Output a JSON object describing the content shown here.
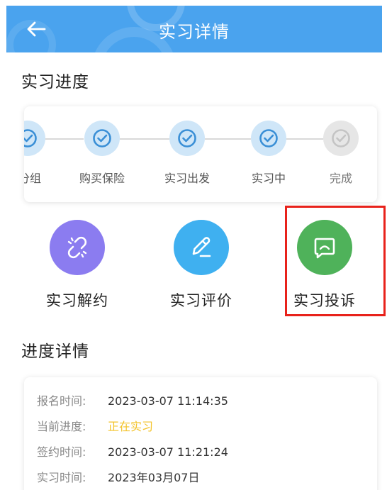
{
  "header": {
    "title": "实习详情"
  },
  "progress": {
    "section_title": "实习进度",
    "steps": [
      {
        "label": "分组",
        "state": "done"
      },
      {
        "label": "购买保险",
        "state": "done"
      },
      {
        "label": "实习出发",
        "state": "done"
      },
      {
        "label": "实习中",
        "state": "done"
      },
      {
        "label": "完成",
        "state": "todo"
      }
    ]
  },
  "actions": [
    {
      "label": "实习解约",
      "icon": "broken-link-icon",
      "color": "#8b7cf0"
    },
    {
      "label": "实习评价",
      "icon": "edit-pen-icon",
      "color": "#3fb0f0"
    },
    {
      "label": "实习投诉",
      "icon": "message-complaint-icon",
      "color": "#4fb25a"
    }
  ],
  "details": {
    "section_title": "进度详情",
    "rows": [
      {
        "key": "报名时间:",
        "value": "2023-03-07 11:14:35"
      },
      {
        "key": "当前进度:",
        "value": "正在实习"
      },
      {
        "key": "签约时间:",
        "value": "2023-03-07 11:21:24"
      },
      {
        "key": "实习时间:",
        "value": "2023年03月07日"
      }
    ]
  },
  "colors": {
    "header": "#4aa3ee",
    "status_text": "#f3c32a",
    "highlight": "#e8221b"
  }
}
